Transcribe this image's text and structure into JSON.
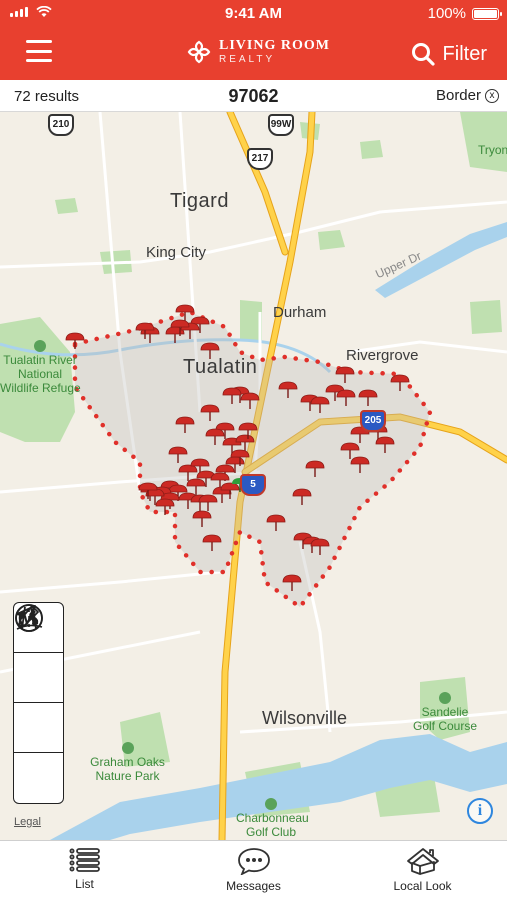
{
  "status_bar": {
    "time": "9:41 AM",
    "battery": "100%",
    "battery_level": 1.0
  },
  "header": {
    "brand_main": "LIVING ROOM",
    "brand_sub": "REALTY",
    "filter_label": "Filter",
    "background_color": "#e8402f"
  },
  "results_bar": {
    "count": "72 results",
    "zip": "97062",
    "border_label": "Border",
    "border_clear": "x"
  },
  "map": {
    "cities": [
      "Tigard",
      "Tualatin",
      "Wilsonville",
      "King City",
      "Durham",
      "Rivergrove",
      "Tryon"
    ],
    "parks": [
      {
        "line1": "Tualatin River",
        "line2": "National",
        "line3": "Wildlife Refuge"
      },
      {
        "line1": "Graham Oaks",
        "line2": "Nature Park"
      },
      {
        "line1": "Sandelie",
        "line2": "Golf Course"
      },
      {
        "line1": "Charbonneau",
        "line2": "Golf Club"
      }
    ],
    "roads": [
      "Upper Dr"
    ],
    "highway_shields": [
      "210",
      "99W",
      "217",
      "205",
      "5"
    ],
    "legal_label": "Legal",
    "info_label": "i",
    "pin_color": "#cc2a24",
    "border_color": "#e0302a"
  },
  "toolbox": [
    "location-arrow-icon",
    "draw-pencil-icon",
    "road-view-icon",
    "globe-icon"
  ],
  "tabs": [
    {
      "label": "List",
      "icon": "list-icon"
    },
    {
      "label": "Messages",
      "icon": "chat-bubble-icon"
    },
    {
      "label": "Local Look",
      "icon": "house-icon"
    }
  ]
}
